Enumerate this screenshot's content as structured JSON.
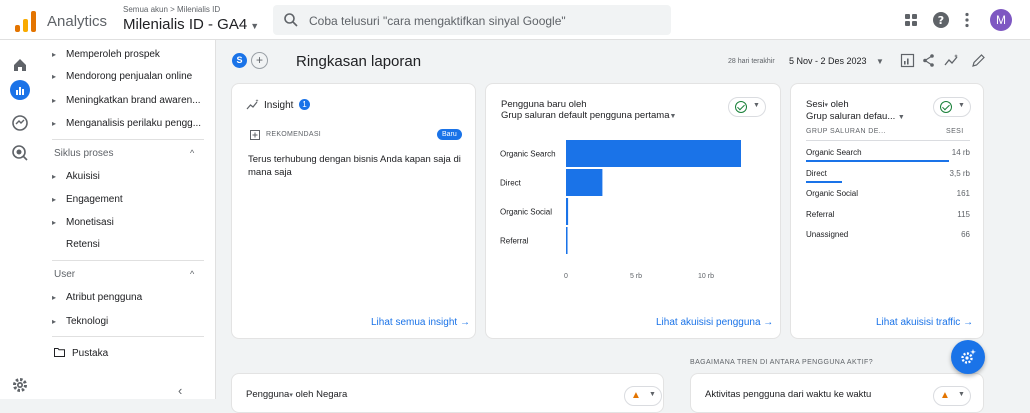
{
  "header": {
    "app_name": "Analytics",
    "account_path": "Semua akun > Milenialis ID",
    "property_name": "Milenialis ID - GA4",
    "search_placeholder": "Coba telusuri \"cara mengaktifkan sinyal Google\"",
    "avatar_letter": "M"
  },
  "sidebar": {
    "items": [
      {
        "label": "Memperoleh prospek"
      },
      {
        "label": "Mendorong penjualan online"
      },
      {
        "label": "Meningkatkan brand awaren..."
      },
      {
        "label": "Menganalisis perilaku pengg..."
      }
    ],
    "lifecycle": {
      "title": "Siklus proses",
      "items": [
        {
          "label": "Akuisisi"
        },
        {
          "label": "Engagement"
        },
        {
          "label": "Monetisasi"
        },
        {
          "label": "Retensi"
        }
      ]
    },
    "user": {
      "title": "User",
      "items": [
        {
          "label": "Atribut pengguna"
        },
        {
          "label": "Teknologi"
        }
      ]
    },
    "library": "Pustaka"
  },
  "page": {
    "badge": "S",
    "title": "Ringkasan laporan",
    "date_label": "28 hari terakhir",
    "date_range": "5 Nov - 2 Des 2023"
  },
  "insight_card": {
    "title": "Insight",
    "count": "1",
    "rec_label": "REKOMENDASI",
    "new_badge": "Baru",
    "text": "Terus terhubung dengan bisnis Anda kapan saja di mana saja",
    "link": "Lihat semua insight →"
  },
  "new_users_card": {
    "title": "Pengguna baru oleh",
    "subtitle": "Grup saluran default pengguna pertama",
    "link": "Lihat akuisisi pengguna →"
  },
  "sessions_card": {
    "title": "Sesi",
    "title_suffix": "oleh",
    "subtitle": "Grup saluran defau...",
    "col1": "GRUP SALURAN DE...",
    "col2": "SESI",
    "rows": [
      {
        "name": "Organic Search",
        "value": "14 rb",
        "share": 0.87
      },
      {
        "name": "Direct",
        "value": "3,5 rb",
        "share": 0.22
      },
      {
        "name": "Organic Social",
        "value": "161",
        "share": 0.01
      },
      {
        "name": "Referral",
        "value": "115",
        "share": 0.007
      },
      {
        "name": "Unassigned",
        "value": "66",
        "share": 0.004
      }
    ],
    "link": "Lihat akuisisi traffic →"
  },
  "trend_heading": "BAGAIMANA TREN DI ANTARA PENGGUNA AKTIF?",
  "bottom_cards": {
    "country_title": "Pengguna",
    "country_suffix": "oleh Negara",
    "activity_title": "Aktivitas pengguna dari waktu ke waktu"
  },
  "chart_data": {
    "type": "bar",
    "orientation": "horizontal",
    "categories": [
      "Organic Search",
      "Direct",
      "Organic Social",
      "Referral"
    ],
    "values": [
      12500,
      2600,
      150,
      110
    ],
    "xlim": [
      0,
      15000
    ],
    "ticks": [
      {
        "value": 0,
        "label": "0"
      },
      {
        "value": 5000,
        "label": "5 rb"
      },
      {
        "value": 10000,
        "label": "10 rb"
      }
    ],
    "bar_color": "#1a73e8"
  },
  "colors": {
    "accent": "#1a73e8",
    "ok": "#188038",
    "warn": "#e37400"
  }
}
